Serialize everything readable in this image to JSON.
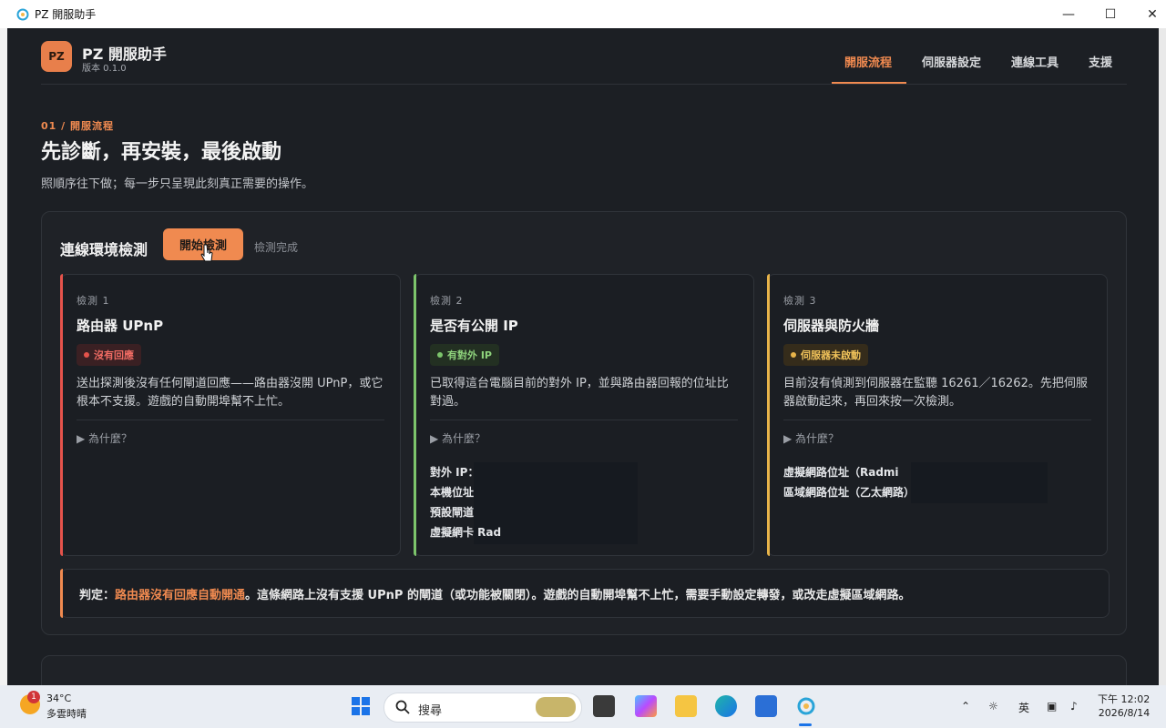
{
  "window": {
    "title": "PZ 開服助手"
  },
  "header": {
    "logo_text": "PZ",
    "brand": "PZ 開服助手",
    "version": "版本 0.1.0",
    "nav": [
      {
        "label": "開服流程",
        "active": true
      },
      {
        "label": "伺服器設定",
        "active": false
      },
      {
        "label": "連線工具",
        "active": false
      },
      {
        "label": "支援",
        "active": false
      }
    ]
  },
  "page": {
    "crumb": "01 / 開服流程",
    "title": "先診斷，再安裝，最後啟動",
    "subtitle": "照順序往下做；每一步只呈現此刻真正需要的操作。"
  },
  "check_panel": {
    "title": "連線環境檢測",
    "start_button": "開始檢測",
    "status": "檢測完成",
    "cards": [
      {
        "kicker": "檢測 1",
        "title": "路由器 UPnP",
        "badge": "沒有回應",
        "badge_color": "#e5534b",
        "desc": "送出探測後沒有任何閘道回應——路由器沒開 UPnP，或它根本不支援。遊戲的自動開埠幫不上忙。",
        "why": "▶ 為什麼？",
        "info": []
      },
      {
        "kicker": "檢測 2",
        "title": "是否有公開 IP",
        "badge": "有對外 IP",
        "badge_color": "#7cc46b",
        "desc": "已取得這台電腦目前的對外 IP，並與路由器回報的位址比對過。",
        "why": "▶ 為什麼？",
        "info": [
          "對外 IP：",
          "本機位址",
          "預設閘道",
          "虛擬網卡 Rad"
        ]
      },
      {
        "kicker": "檢測 3",
        "title": "伺服器與防火牆",
        "badge": "伺服器未啟動",
        "badge_color": "#e8b44a",
        "desc": "目前沒有偵測到伺服器在監聽 16261／16262。先把伺服器啟動起來，再回來按一次檢測。",
        "why": "▶ 為什麼？",
        "info": [
          "虛擬網路位址（Radmi",
          "區域網路位址（乙太網路）"
        ]
      }
    ],
    "verdict": {
      "prefix": "判定：",
      "highlight": "路由器沒有回應自動開通",
      "text": "。這條網路上沒有支援 UPnP 的閘道（或功能被關閉）。遊戲的自動開埠幫不上忙，需要手動設定轉發，或改走虛擬區域網路。"
    }
  },
  "taskbar": {
    "weather_badge": "1",
    "temp": "34°C",
    "weather": "多雲時晴",
    "search": "搜尋",
    "ime": "英",
    "time": "下午 12:02",
    "date": "2026/8/14"
  },
  "colors": {
    "accent": "#f08a50",
    "background": "#1c1f24"
  }
}
